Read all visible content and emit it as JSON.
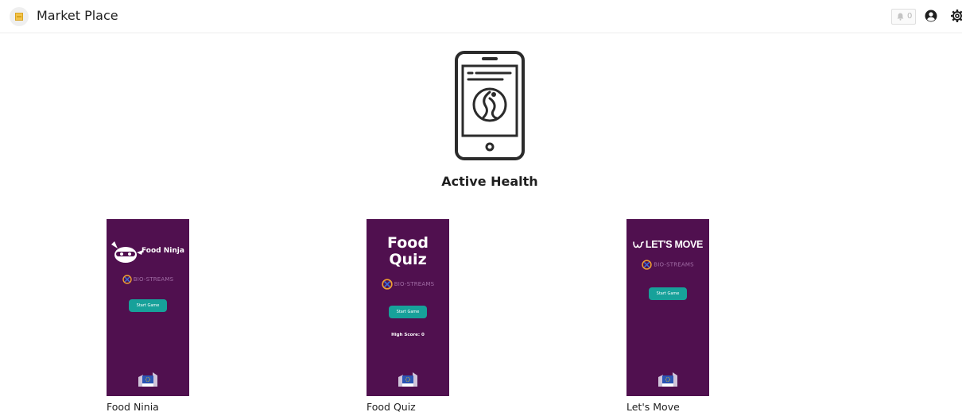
{
  "header": {
    "title": "Market Place",
    "notification_count": "0"
  },
  "hero": {
    "title": "Active Health",
    "icon": "phone-app-icon"
  },
  "colors": {
    "card_background": "#50104f",
    "start_button": "#17a19a",
    "brand_text": "#a06ca4"
  },
  "apps": [
    {
      "label": "Food Ninia",
      "thumb_title": "Food Ninja",
      "brand": "BIO-STREAMS",
      "button": "Start Game"
    },
    {
      "label": "Food Quiz",
      "thumb_title_line1": "Food",
      "thumb_title_line2": "Quiz",
      "brand": "BIO-STREAMS",
      "button": "Start Game",
      "high_score": "High Score: 0"
    },
    {
      "label": "Let's Move",
      "thumb_title": "LET'S MOVE",
      "brand": "BIO-STREAMS",
      "button": "Start Game"
    }
  ]
}
